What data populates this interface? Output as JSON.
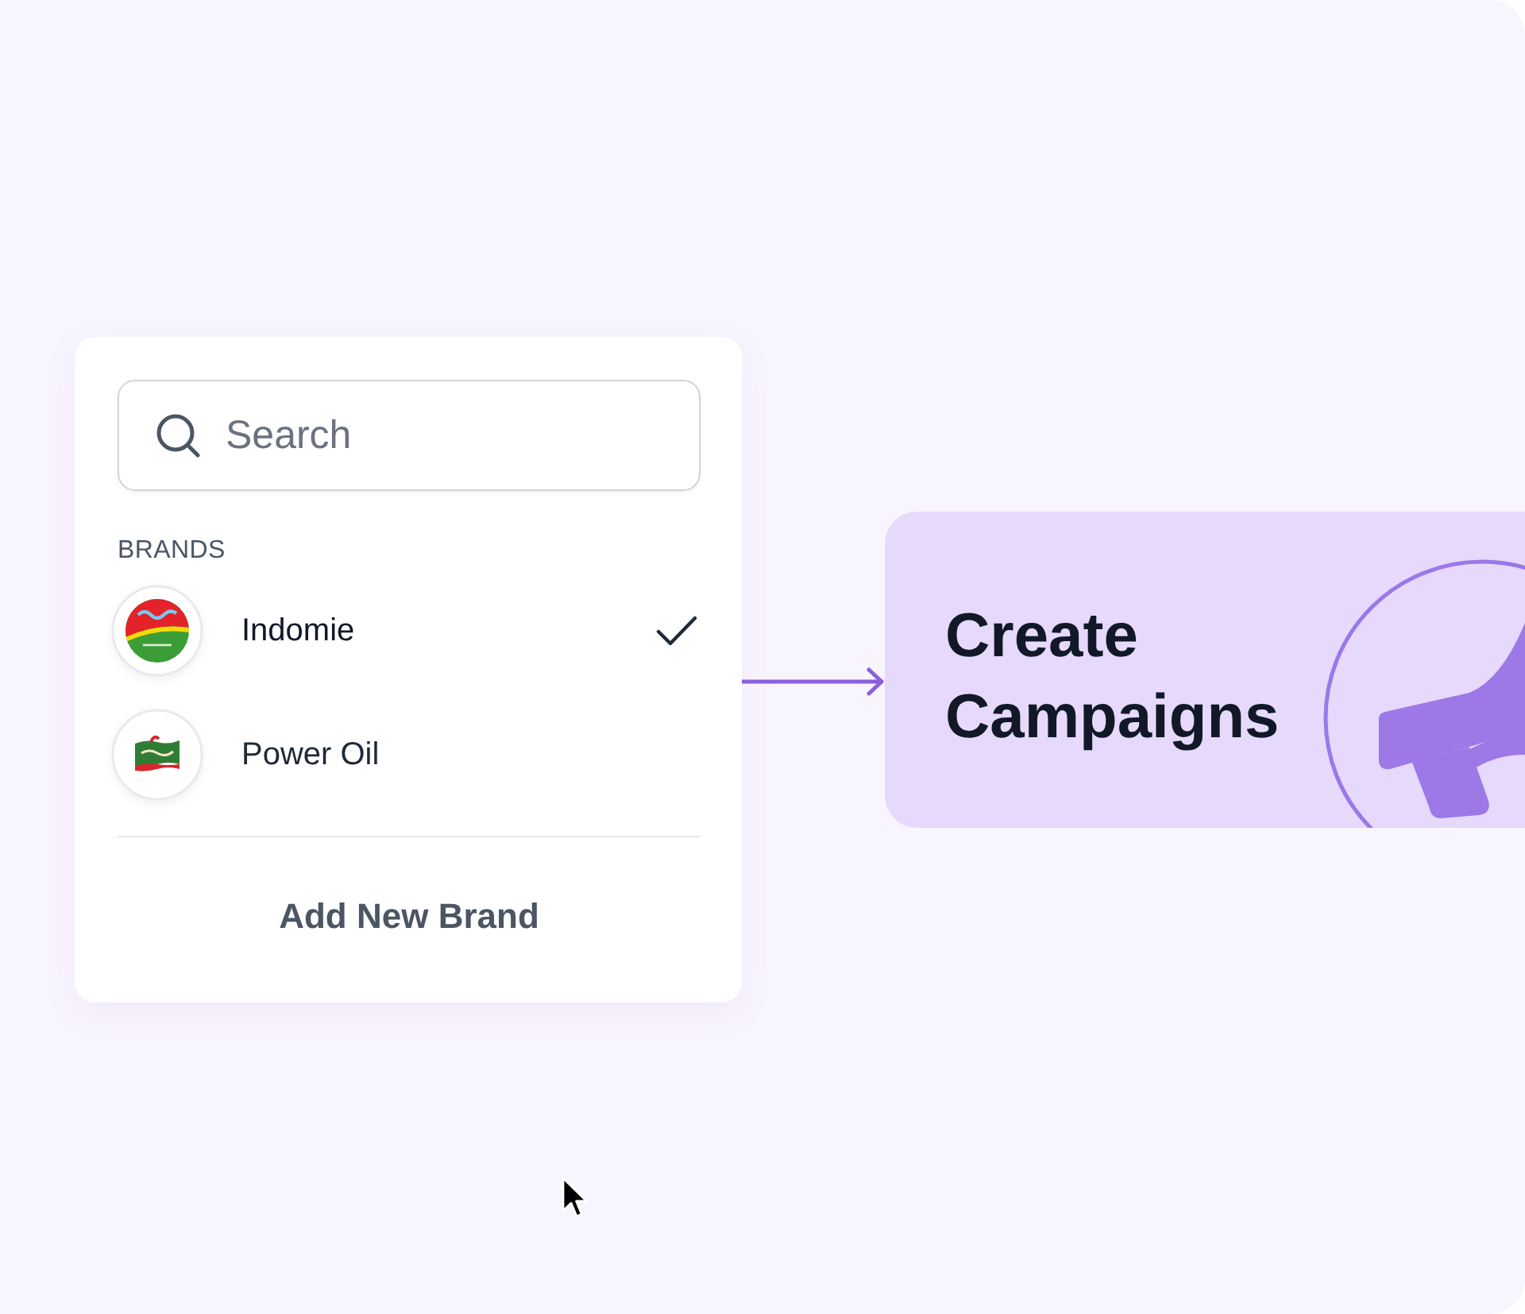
{
  "search": {
    "placeholder": "Search"
  },
  "brands": {
    "heading": "BRANDS",
    "items": [
      {
        "name": "Indomie",
        "selected": true
      },
      {
        "name": "Power Oil",
        "selected": false
      }
    ],
    "add_button": "Add New Brand"
  },
  "campaign": {
    "title": "Create Campaigns"
  }
}
